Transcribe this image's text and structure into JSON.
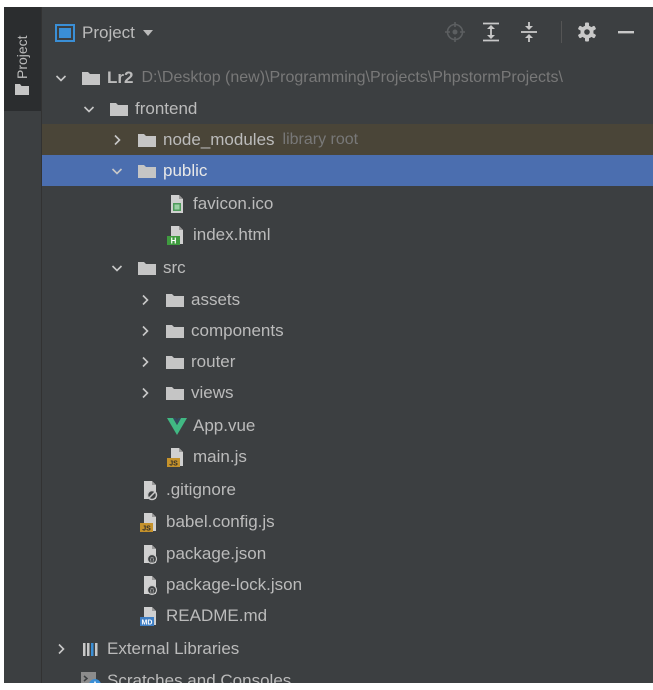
{
  "side_strip": {
    "tab_label": "Project"
  },
  "header": {
    "title": "Project"
  },
  "tree": {
    "root": {
      "name": "Lr2",
      "path": "D:\\Desktop (new)\\Programming\\Projects\\PhpstormProjects\\"
    },
    "frontend": "frontend",
    "node_modules": {
      "name": "node_modules",
      "hint": "library root"
    },
    "public": "public",
    "favicon": "favicon.ico",
    "index_html": "index.html",
    "src": "src",
    "assets": "assets",
    "components": "components",
    "router": "router",
    "views": "views",
    "app_vue": "App.vue",
    "main_js": "main.js",
    "gitignore": ".gitignore",
    "babel_config": "babel.config.js",
    "package_json": "package.json",
    "package_lock": "package-lock.json",
    "readme": "README.md",
    "external_libraries": "External Libraries",
    "scratches": "Scratches and Consoles"
  },
  "badges": {
    "html": "H",
    "js": "JS",
    "md": "MD"
  },
  "colors": {
    "panel_bg": "#3c3f41",
    "selection": "#4b6eaf",
    "library_root_bg": "#4a4538",
    "text": "#bbbbbb",
    "hint": "#787878",
    "vue_green": "#41b883",
    "js_orange": "#c5922b",
    "html_green": "#3f9b3f",
    "md_blue": "#3f7fc5"
  },
  "icons": [
    "project-view-icon",
    "dropdown-icon",
    "locate-icon",
    "expand-all-icon",
    "collapse-all-icon",
    "gear-icon",
    "hide-icon",
    "chevron-right-icon",
    "chevron-down-icon",
    "folder-icon",
    "file-icon",
    "vue-icon",
    "ignore-file-icon",
    "json-file-icon",
    "libraries-icon",
    "scratches-icon"
  ]
}
